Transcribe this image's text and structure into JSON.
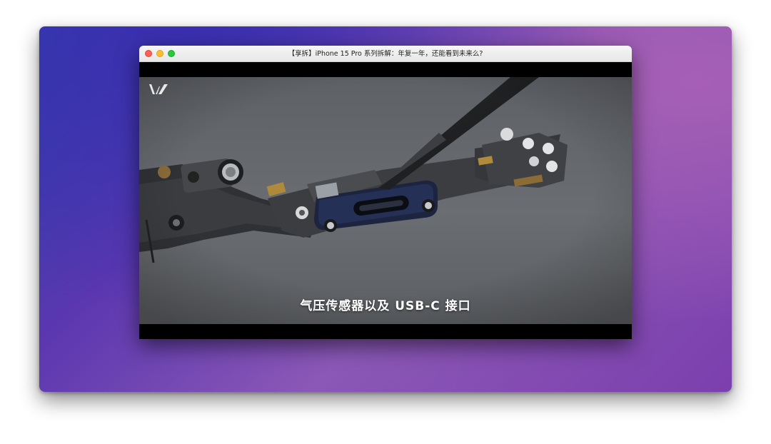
{
  "window": {
    "title": "【享拆】iPhone 15 Pro 系列拆解：年复一年，还能看到未来么?"
  },
  "video": {
    "subtitle": "气压传感器以及 USB-C 接口",
    "channel_logo_icon": "w-logo-icon"
  },
  "colors": {
    "close": "#fe5f57",
    "minimize": "#febc2e",
    "maximize": "#28c840"
  }
}
